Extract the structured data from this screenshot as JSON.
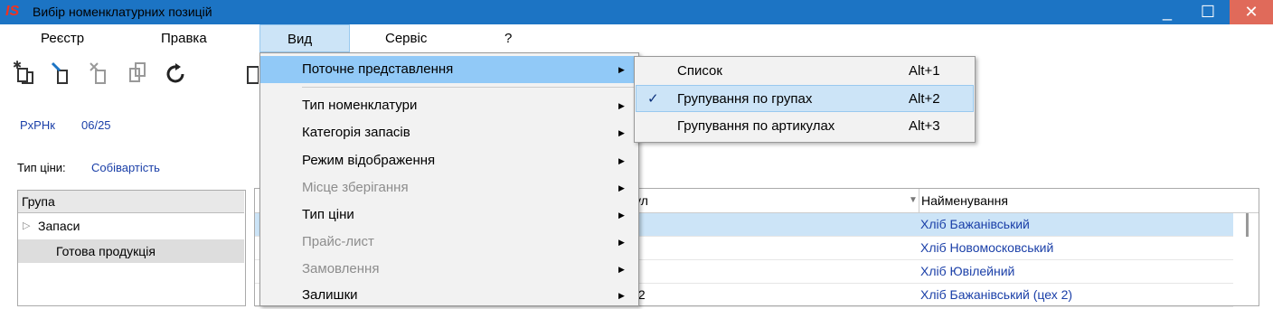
{
  "window": {
    "title": "Вибір номенклатурних позицій",
    "logo_text": "IS",
    "controls": {
      "minimize": "_",
      "maximize": "☐",
      "close": "✕"
    }
  },
  "menubar": [
    "Реєстр",
    "Правка",
    "Вид",
    "Сервіс",
    "?"
  ],
  "toolbar": {
    "icons": [
      "add-item-icon",
      "edit-item-icon",
      "delete-item-icon",
      "copy-item-icon",
      "refresh-icon",
      "more-icon"
    ]
  },
  "info": {
    "doc_code": "РхРНк",
    "period": "06/25",
    "price_type_label": "Тип ціни:",
    "price_type_value": "Собівартість"
  },
  "groups": {
    "header": "Група",
    "items": [
      {
        "label": "Запаси",
        "expander": "▷"
      },
      {
        "label": "Готова продукція"
      }
    ]
  },
  "grid": {
    "columns": [
      "Артикул",
      "Найменування"
    ],
    "visible_article_header": "ул",
    "rows": [
      {
        "article": "",
        "name": "Хліб Бажанівський"
      },
      {
        "article": "",
        "name": "Хліб Новомосковський"
      },
      {
        "article": "",
        "name": "Хліб Ювілейний"
      },
      {
        "article": "/2",
        "name": "Хліб Бажанівський (цех 2)"
      }
    ]
  },
  "dropdown": {
    "items": [
      {
        "label": "Поточне представлення",
        "submenu": true,
        "disabled": false,
        "highlight": true
      },
      {
        "label": "Тип номенклатури",
        "submenu": true,
        "disabled": false
      },
      {
        "label": "Категорія запасів",
        "submenu": true,
        "disabled": false
      },
      {
        "label": "Режим відображення",
        "submenu": true,
        "disabled": false
      },
      {
        "label": "Місце зберігання",
        "submenu": true,
        "disabled": true
      },
      {
        "label": "Тип ціни",
        "submenu": true,
        "disabled": false
      },
      {
        "label": "Прайс-лист",
        "submenu": true,
        "disabled": true
      },
      {
        "label": "Замовлення",
        "submenu": true,
        "disabled": true
      },
      {
        "label": "Залишки",
        "submenu": true,
        "disabled": false
      }
    ]
  },
  "submenu": {
    "items": [
      {
        "label": "Список",
        "shortcut": "Alt+1",
        "checked": false
      },
      {
        "label": "Групування по групах",
        "shortcut": "Alt+2",
        "checked": true
      },
      {
        "label": "Групування по артикулах",
        "shortcut": "Alt+3",
        "checked": false
      }
    ],
    "check_glyph": "✓"
  },
  "colors": {
    "titlebar": "#1c74c4",
    "close": "#e06a5a",
    "selection": "#cce4f7",
    "menu_highlight": "#91c9f7",
    "link_text": "#1a3fa8"
  }
}
